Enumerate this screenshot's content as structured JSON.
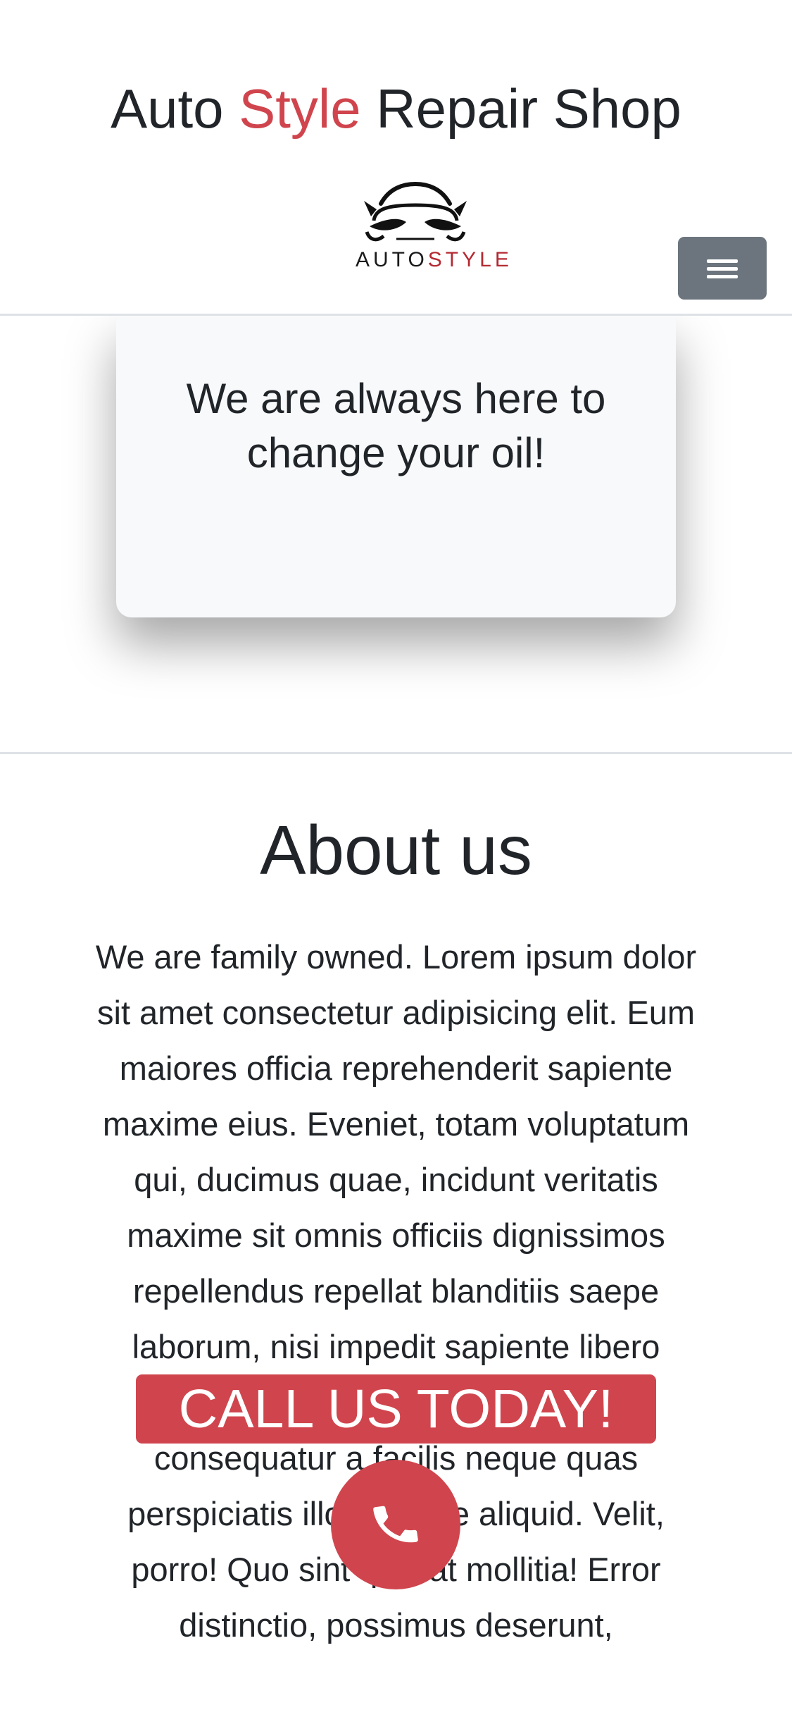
{
  "header": {
    "title_part1": "Auto ",
    "title_accent": "Style",
    "title_part2": " Repair Shop",
    "logo_text_part1": "AUTO",
    "logo_text_part2": "STYLE",
    "menu_icon": "hamburger-menu-icon"
  },
  "hero": {
    "text": "We are always here to change your oil!"
  },
  "about": {
    "title": "About us",
    "body": "We are family owned. Lorem ipsum dolor sit amet consectetur adipisicing elit. Eum maiores officia reprehenderit sapiente maxime eius. Eveniet, totam voluptatum qui, ducimus quae, incidunt veritatis maxime sit omnis officiis dignissimos repellendus repellat blanditiis saepe laborum, nisi impedit sapiente libero omnis consectetur iste. Cum porro consequatur a facilis neque quas perspiciatis illo cumque aliquid. Velit, porro! Quo sint quis at mollitia! Error distinctio, possimus deserunt,"
  },
  "cta": {
    "banner_label": "CALL US TODAY!",
    "call_icon": "phone-icon"
  },
  "colors": {
    "accent": "#d0454d",
    "menu_button": "#6c757d",
    "card_background": "#f8f9fa",
    "text": "#212529"
  }
}
